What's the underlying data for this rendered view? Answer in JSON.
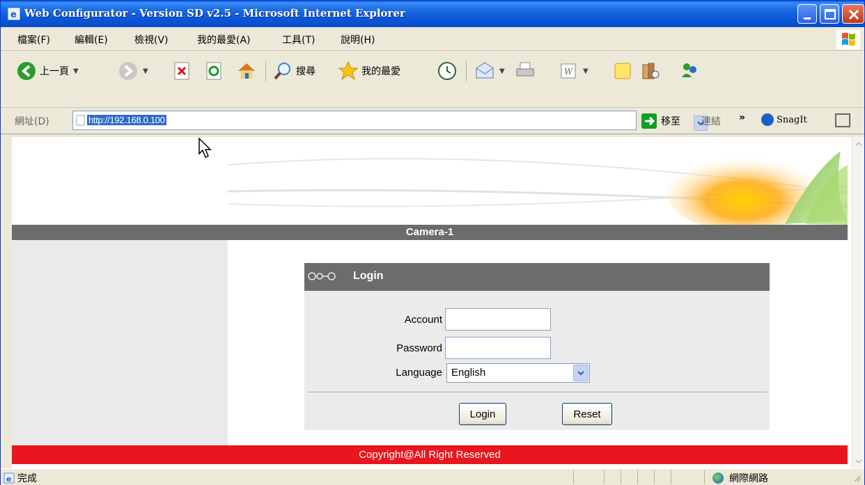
{
  "window": {
    "title": "Web Configurator - Version SD v2.5 - Microsoft Internet Explorer"
  },
  "menu": {
    "items": [
      "檔案(F)",
      "編輯(E)",
      "檢視(V)",
      "我的最愛(A)",
      "工具(T)",
      "說明(H)"
    ]
  },
  "toolbar": {
    "back_label": "上一頁",
    "search_label": "搜尋",
    "favorites_label": "我的最愛"
  },
  "address": {
    "label": "網址(D)",
    "url": "http://192.168.0.100",
    "go_label": "移至",
    "links_label": "連結",
    "snagit_label": "SnagIt"
  },
  "page": {
    "camera_title": "Camera-1",
    "login_header": "Login",
    "account_label": "Account",
    "account_value": "",
    "password_label": "Password",
    "password_value": "",
    "language_label": "Language",
    "language_value": "English",
    "login_button": "Login",
    "reset_button": "Reset",
    "footer": "Copyright@All Right Reserved"
  },
  "status": {
    "text": "完成",
    "zone": "網際網路"
  },
  "colors": {
    "title_strip": "#6c6c6c",
    "footer": "#e8171f",
    "left_panel": "#eaeaea"
  }
}
